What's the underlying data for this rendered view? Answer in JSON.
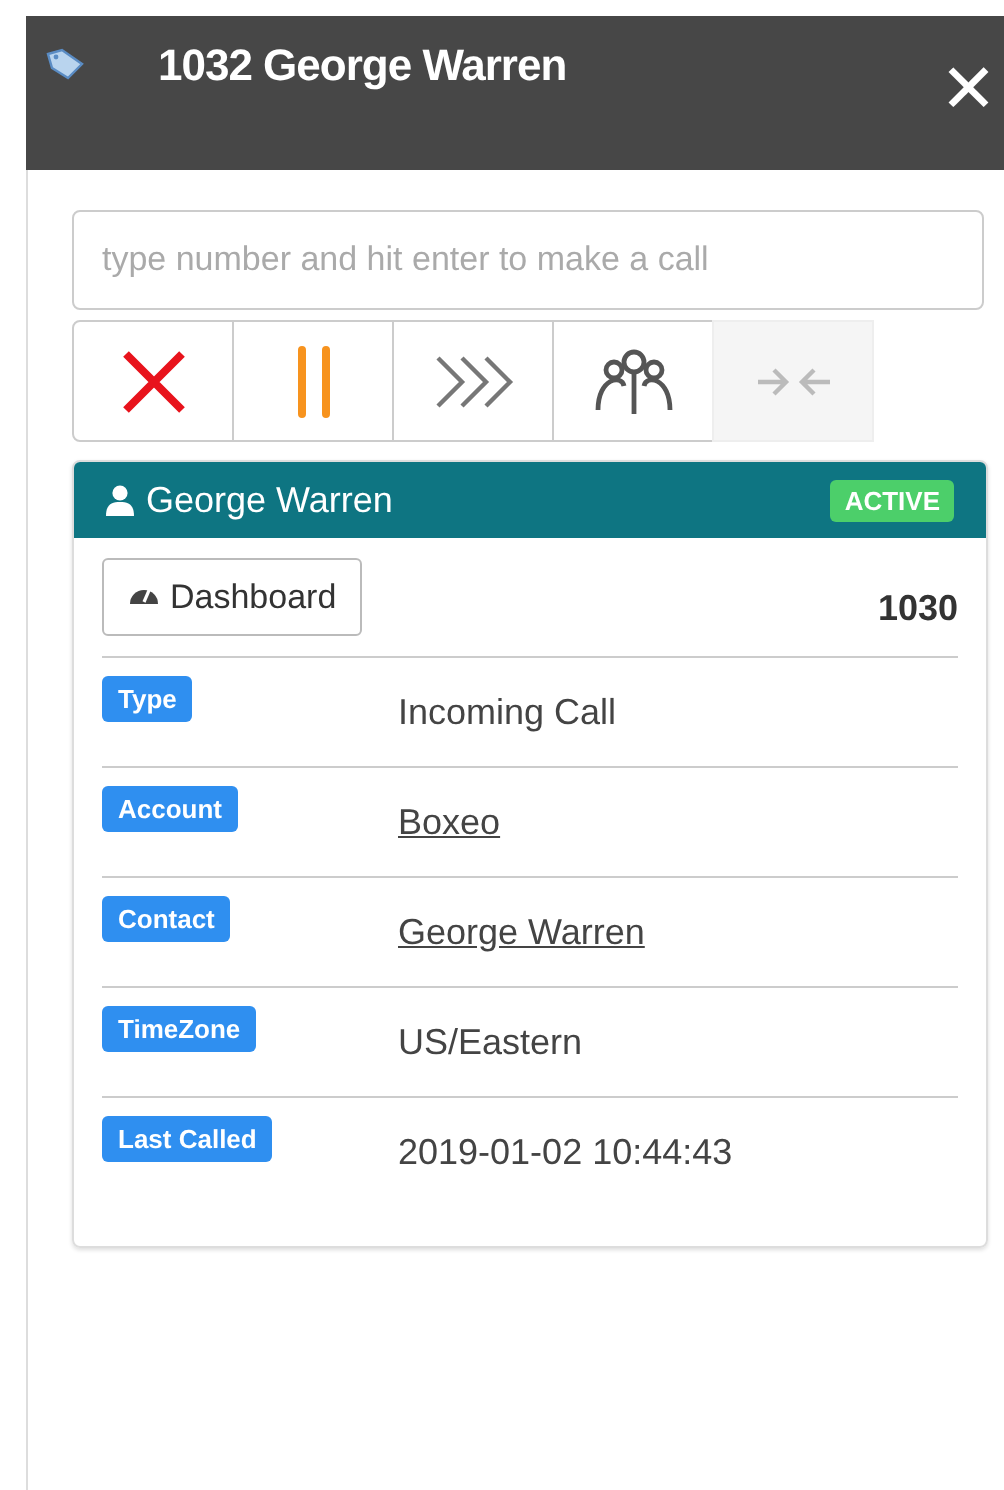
{
  "header": {
    "title": "1032 George Warren",
    "close": "✕"
  },
  "dial": {
    "placeholder": "type number and hit enter to make a call"
  },
  "actions": [
    {
      "kind": "hangup",
      "disabled": false
    },
    {
      "kind": "hold",
      "disabled": false
    },
    {
      "kind": "transfer",
      "disabled": false
    },
    {
      "kind": "conference",
      "disabled": false
    },
    {
      "kind": "merge",
      "disabled": true
    }
  ],
  "card": {
    "name": "George Warren",
    "status": "ACTIVE",
    "dashboard": "Dashboard",
    "extension": "1030",
    "rows": [
      {
        "label": "Type",
        "value": "Incoming Call",
        "kind": "text"
      },
      {
        "label": "Account",
        "value": "Boxeo",
        "kind": "link"
      },
      {
        "label": "Contact",
        "value": "George Warren",
        "kind": "link"
      },
      {
        "label": "TimeZone",
        "value": "US/Eastern",
        "kind": "text"
      },
      {
        "label": "Last Called",
        "value": "2019-01-02 10:44:43",
        "kind": "text"
      }
    ]
  }
}
